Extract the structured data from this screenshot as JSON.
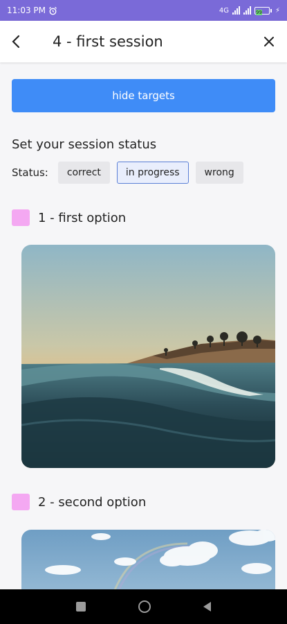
{
  "status_bar": {
    "time": "11:03 PM",
    "alarm_icon": "alarm-clock-icon",
    "network": "4G",
    "battery": "99"
  },
  "app_bar": {
    "back_icon": "back-arrow-icon",
    "title": "4 - first session",
    "close_icon": "close-icon"
  },
  "main": {
    "hide_targets_label": "hide targets",
    "session_status_title": "Set your session status",
    "status_label": "Status:",
    "status_options": [
      "correct",
      "in progress",
      "wrong"
    ],
    "selected_status": "in progress",
    "options": [
      {
        "label": "1 - first option"
      },
      {
        "label": "2 - second option"
      }
    ]
  },
  "colors": {
    "accent": "#3f8cf7",
    "status_bar": "#7a6ad8",
    "checkbox": "#f4a8f2"
  }
}
